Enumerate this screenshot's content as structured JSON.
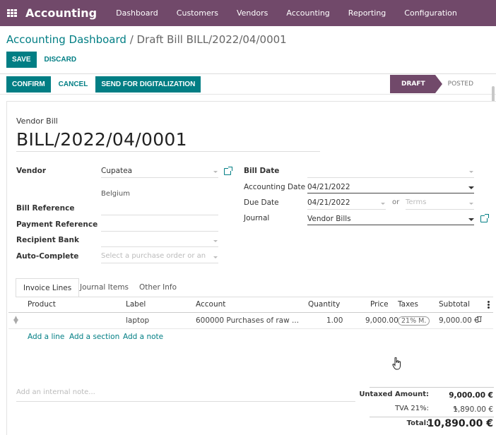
{
  "navbar": {
    "app_title": "Accounting",
    "menu": [
      "Dashboard",
      "Customers",
      "Vendors",
      "Accounting",
      "Reporting",
      "Configuration"
    ]
  },
  "breadcrumb": {
    "parent": "Accounting Dashboard",
    "separator": "/",
    "current": "Draft Bill BILL/2022/04/0001"
  },
  "buttons": {
    "save": "SAVE",
    "discard": "DISCARD",
    "confirm": "CONFIRM",
    "cancel": "CANCEL",
    "digitalize": "SEND FOR DIGITALIZATION"
  },
  "status": {
    "draft": "DRAFT",
    "posted": "POSTED"
  },
  "form": {
    "doc_type": "Vendor Bill",
    "doc_name": "BILL/2022/04/0001",
    "vendor_label": "Vendor",
    "vendor_value": "Cupatea",
    "vendor_country": "Belgium",
    "bill_reference_label": "Bill Reference",
    "payment_reference_label": "Payment Reference",
    "recipient_bank_label": "Recipient Bank",
    "auto_complete_label": "Auto-Complete",
    "auto_complete_placeholder": "Select a purchase order or an ol",
    "bill_date_label": "Bill Date",
    "accounting_date_label": "Accounting Date",
    "accounting_date_value": "04/21/2022",
    "due_date_label": "Due Date",
    "due_date_value": "04/21/2022",
    "or": "or",
    "terms_placeholder": "Terms",
    "journal_label": "Journal",
    "journal_value": "Vendor Bills"
  },
  "tabs": [
    "Invoice Lines",
    "Journal Items",
    "Other Info"
  ],
  "table": {
    "headers": [
      "Product",
      "Label",
      "Account",
      "Quantity",
      "Price",
      "Taxes",
      "Subtotal"
    ],
    "rows": [
      {
        "product": "",
        "label": "laptop",
        "account": "600000 Purchases of raw ...",
        "quantity": "1.00",
        "price": "9,000.00",
        "taxes": "21% M.",
        "subtotal": "9,000.00 €"
      }
    ],
    "add_line": "Add a line",
    "add_section": "Add a section",
    "add_note": "Add a note"
  },
  "internal_note_placeholder": "Add an internal note...",
  "totals": {
    "untaxed_label": "Untaxed Amount:",
    "untaxed_value": "9,000.00 €",
    "tax_label": "TVA 21%:",
    "tax_value": "1,890.00 €",
    "total_label": "Total:",
    "total_value": "10,890.00 €"
  },
  "colors": {
    "brand": "#71496a",
    "accent": "#017e84"
  }
}
